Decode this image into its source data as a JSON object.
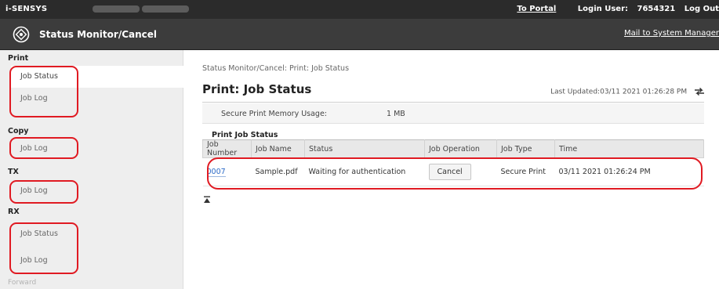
{
  "topbar": {
    "brand": "i-SENSYS",
    "portal": "To Portal",
    "login_label": "Login User:",
    "login_user": "7654321",
    "logout": "Log Out"
  },
  "header": {
    "title": "Status Monitor/Cancel",
    "mail_link": "Mail to System Manager"
  },
  "sidebar": {
    "print": {
      "heading": "Print",
      "job_status": "Job Status",
      "job_log": "Job Log"
    },
    "copy": {
      "heading": "Copy",
      "job_log": "Job Log"
    },
    "tx": {
      "heading": "TX",
      "job_log": "Job Log"
    },
    "rx": {
      "heading": "RX",
      "job_status": "Job Status",
      "job_log": "Job Log"
    },
    "forward": "Forward"
  },
  "main": {
    "breadcrumb": "Status Monitor/Cancel: Print: Job Status",
    "title": "Print: Job Status",
    "last_updated": "Last Updated:03/11 2021 01:26:28 PM",
    "memory_label": "Secure Print Memory Usage:",
    "memory_value": "1 MB",
    "section_title": "Print Job Status",
    "columns": [
      "Job Number",
      "Job Name",
      "Status",
      "Job Operation",
      "Job Type",
      "Time"
    ],
    "row": {
      "job_number": "0007",
      "job_name": "Sample.pdf",
      "status": "Waiting for authentication",
      "operation": "Cancel",
      "job_type": "Secure Print",
      "time": "03/11 2021 01:26:24 PM"
    }
  },
  "colors": {
    "highlight": "#e01a22",
    "topbar": "#2b2b2b",
    "header": "#3c3c3c",
    "link": "#2b6ac7"
  }
}
